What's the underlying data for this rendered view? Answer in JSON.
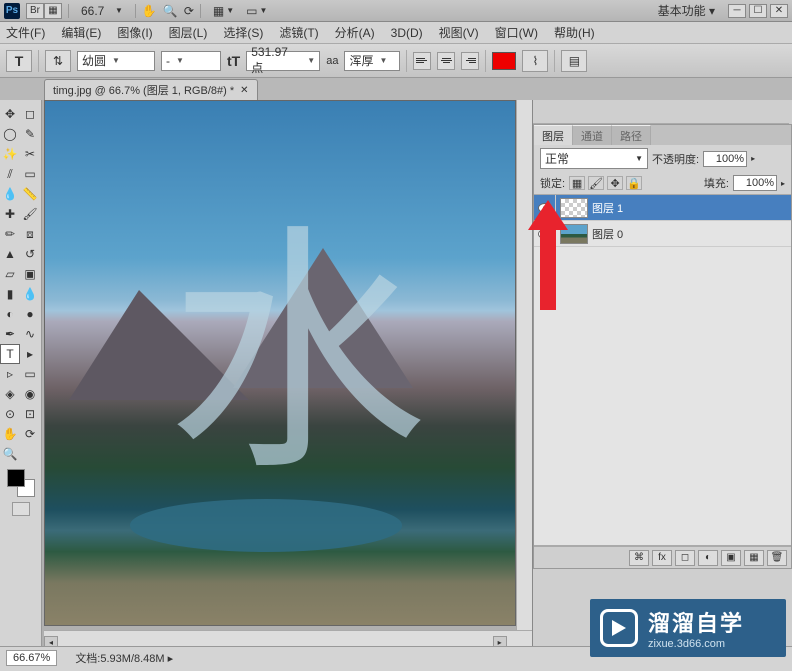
{
  "titlebar": {
    "zoom": "66.7",
    "workspace": "基本功能"
  },
  "menu": {
    "file": "文件(F)",
    "edit": "编辑(E)",
    "image": "图像(I)",
    "layer": "图层(L)",
    "select": "选择(S)",
    "filter": "滤镜(T)",
    "analysis": "分析(A)",
    "threed": "3D(D)",
    "view": "视图(V)",
    "window": "窗口(W)",
    "help": "帮助(H)"
  },
  "options": {
    "font_family": "幼圆",
    "font_style": "-",
    "font_size": "531.97 点",
    "aa_label": "aa",
    "anti_alias": "浑厚"
  },
  "doc_tab": {
    "title": "timg.jpg @ 66.7% (图层 1, RGB/8#) *"
  },
  "panels": {
    "tabs": {
      "layers": "图层",
      "channels": "通道",
      "paths": "路径"
    },
    "blend_mode": "正常",
    "opacity_label": "不透明度:",
    "opacity": "100%",
    "lock_label": "锁定:",
    "fill_label": "填充:",
    "fill": "100%",
    "layers": [
      {
        "name": "图层 1",
        "thumb": "checker",
        "selected": true
      },
      {
        "name": "图层 0",
        "thumb": "landscape",
        "selected": false
      }
    ]
  },
  "status": {
    "zoom": "66.67%",
    "doc_info": "文档:5.93M/8.48M"
  },
  "canvas": {
    "text_char": "水"
  },
  "watermark": {
    "cn": "溜溜自学",
    "url": "zixue.3d66.com"
  }
}
